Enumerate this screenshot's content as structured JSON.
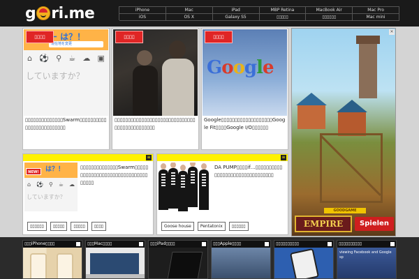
{
  "site": {
    "logo": "gori.me",
    "logo_pre": "g",
    "logo_post": "ri.me"
  },
  "devnav": [
    "iPhone",
    "Mac",
    "iPad",
    "MBP Retina",
    "MacBook Air",
    "Mac Pro",
    "iOS",
    "OS X",
    "Galaxy S5",
    "▯▯▯▯▯",
    "▯▯▯▯▯▯",
    "Mac mini"
  ],
  "devnav_row2_last": "▯▯▯▯▯▯",
  "tag_label": "▯▯▯▯",
  "top_cards": [
    {
      "image": "swarm-app-screenshot",
      "banner_text": "ー は？！",
      "banner_location": "現在地を変更",
      "question": "していますか？",
      "title": "▯▯▯▯▯▯▯▯▯▯▯▯▯▯Swarm▯▯▯▯▯▯▯▯▯▯▯▯▯▯▯▯▯▯▯▯▯▯▯▯▯"
    },
    {
      "image": "people-with-phones-photo",
      "title": "▯▯▯▯▯▯▯▯▯▯▯▯▯▯▯▯▯▯▯▯▯▯▯▯▯▯▯▯▯▯▯▯▯▯▯▯▯▯▯▯▯▯▯▯▯"
    },
    {
      "image": "google-logo-photo",
      "google_word": "Google",
      "title": "Google▯▯▯▯▯▯▯▯▯▯▯▯▯▯▯▯▯▯▯Google Fit▯▯▯▯Google I/O▯▯▯▯▯▯"
    }
  ],
  "wide_cards": [
    {
      "new_label": "NEW!",
      "banner_text": "は？！",
      "question": "していますか？",
      "title": "▯▯▯▯▯▯▯▯▯▯▯▯▯▯Swarm▯▯▯▯▯▯▯▯▯▯▯▯▯▯▯▯▯▯▯▯▯▯▯▯▯▯▯▯▯▯▯▯▯▯▯",
      "tags": [
        "▯▯▯▯▯▯",
        "▯▯▯▯▯",
        "▯▯▯▯▯",
        "▯▯▯▯"
      ]
    },
    {
      "title": "DA PUMP▯▯▯▯if…▯▯▯▯▯▯▯▯▯▯▯▯▯▯▯▯▯▯▯▯▯▯▯▯▯▯▯▯▯▯▯▯",
      "tags": [
        "Goose house",
        "Pentatonix",
        "▯▯▯▯▯▯"
      ]
    }
  ],
  "ad": {
    "close": "✕",
    "brand": "GOODGAME",
    "title": "EMPIRE",
    "cta": "Spielen"
  },
  "bottom_strip": [
    {
      "label": "▯▯▯iPhone▯▯▯▯"
    },
    {
      "label": "▯▯▯Mac▯▯▯▯"
    },
    {
      "label": "▯▯▯iPad▯▯▯▯"
    },
    {
      "label": "▯▯▯Apple▯▯▯▯"
    },
    {
      "label": "▯▯▯▯▯▯▯▯▯▯"
    },
    {
      "label": "▯▯▯▯▯▯▯▯▯▯",
      "preview": "viewing Facebook and Google sp"
    }
  ],
  "colors": {
    "tag_red": "#e02525",
    "bar_yellow": "#fff200",
    "header": "#1a1a1a"
  }
}
